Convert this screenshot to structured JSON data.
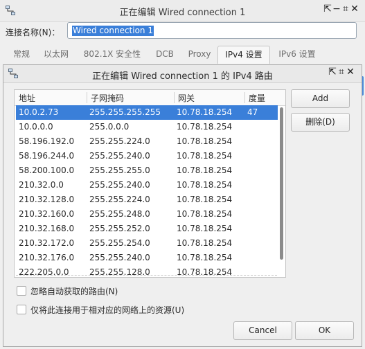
{
  "window": {
    "title": "正在编辑 Wired connection 1",
    "controls": [
      "⇱",
      "−",
      "⌗",
      "✕"
    ]
  },
  "connection": {
    "label": "连接名称(N)：",
    "value": "Wired connection 1"
  },
  "tabs": [
    {
      "label": "常规"
    },
    {
      "label": "以太网"
    },
    {
      "label": "802.1X 安全性"
    },
    {
      "label": "DCB"
    },
    {
      "label": "Proxy"
    },
    {
      "label": "IPv4 设置"
    },
    {
      "label": "IPv6 设置"
    }
  ],
  "active_tab": "IPv4 设置",
  "dialog": {
    "title": "正在编辑 Wired connection 1 的 IPv4 路由",
    "columns": [
      "地址",
      "子网掩码",
      "网关",
      "度量"
    ],
    "routes": [
      [
        "10.0.2.73",
        "255.255.255.255",
        "10.78.18.254",
        "47"
      ],
      [
        "10.0.0.0",
        "255.0.0.0",
        "10.78.18.254",
        ""
      ],
      [
        "58.196.192.0",
        "255.255.224.0",
        "10.78.18.254",
        ""
      ],
      [
        "58.196.244.0",
        "255.255.240.0",
        "10.78.18.254",
        ""
      ],
      [
        "58.200.100.0",
        "255.255.255.0",
        "10.78.18.254",
        ""
      ],
      [
        "210.32.0.0",
        "255.255.240.0",
        "10.78.18.254",
        ""
      ],
      [
        "210.32.128.0",
        "255.255.224.0",
        "10.78.18.254",
        ""
      ],
      [
        "210.32.160.0",
        "255.255.248.0",
        "10.78.18.254",
        ""
      ],
      [
        "210.32.168.0",
        "255.255.252.0",
        "10.78.18.254",
        ""
      ],
      [
        "210.32.172.0",
        "255.255.254.0",
        "10.78.18.254",
        ""
      ],
      [
        "210.32.176.0",
        "255.255.240.0",
        "10.78.18.254",
        ""
      ],
      [
        "222.205.0.0",
        "255.255.128.0",
        "10.78.18.254",
        ""
      ]
    ],
    "add_label": "Add",
    "delete_label": "删除(D)",
    "ignore_auto_label": "忽略自动获取的路由(N)",
    "only_resources_label": "仅将此连接用于相对应的网络上的资源(U)",
    "cancel_label": "Cancel",
    "ok_label": "OK"
  }
}
